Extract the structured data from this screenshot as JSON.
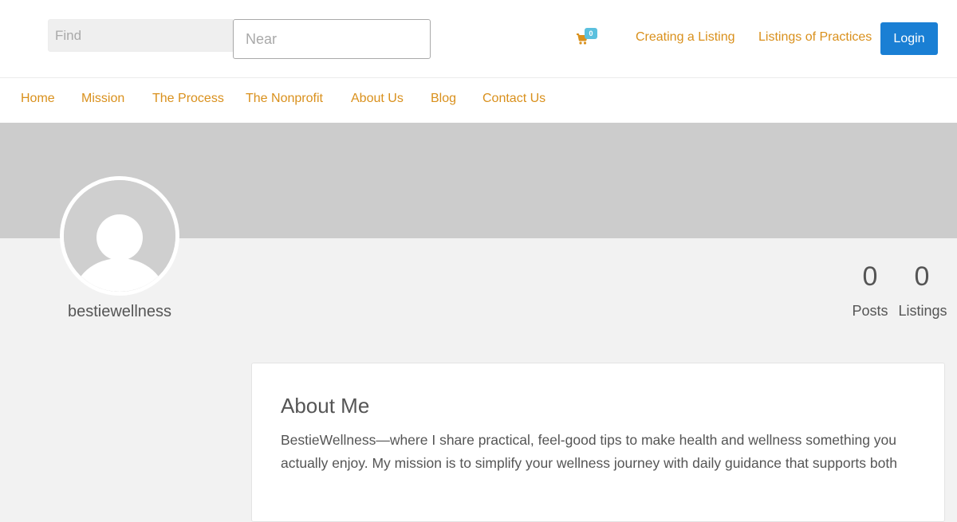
{
  "header": {
    "find_placeholder": "Find",
    "near_placeholder": "Near",
    "cart_icon": "shopping-cart-icon",
    "cart_count": "0",
    "links": [
      "Creating a Listing",
      "Listings of Practices"
    ],
    "login_label": "Login"
  },
  "nav": {
    "items": [
      "Home",
      "Mission",
      "The Process",
      "The Nonprofit",
      "About Us",
      "Blog",
      "Contact Us"
    ]
  },
  "profile": {
    "avatar_icon": "default-user-avatar-icon",
    "username": "bestiewellness",
    "stats": [
      {
        "value": "0",
        "label": "Posts"
      },
      {
        "value": "0",
        "label": "Listings"
      }
    ]
  },
  "about": {
    "title": "About Me",
    "text": "BestieWellness—where I share practical, feel-good tips to make health and wellness something you actually enjoy. My mission is to simplify your wellness journey with daily guidance that supports both"
  },
  "colors": {
    "link": "#d9901c",
    "button": "#1a7fd4",
    "badge": "#5bc0de",
    "cover": "#cccccc",
    "page_bg": "#f2f2f2"
  }
}
